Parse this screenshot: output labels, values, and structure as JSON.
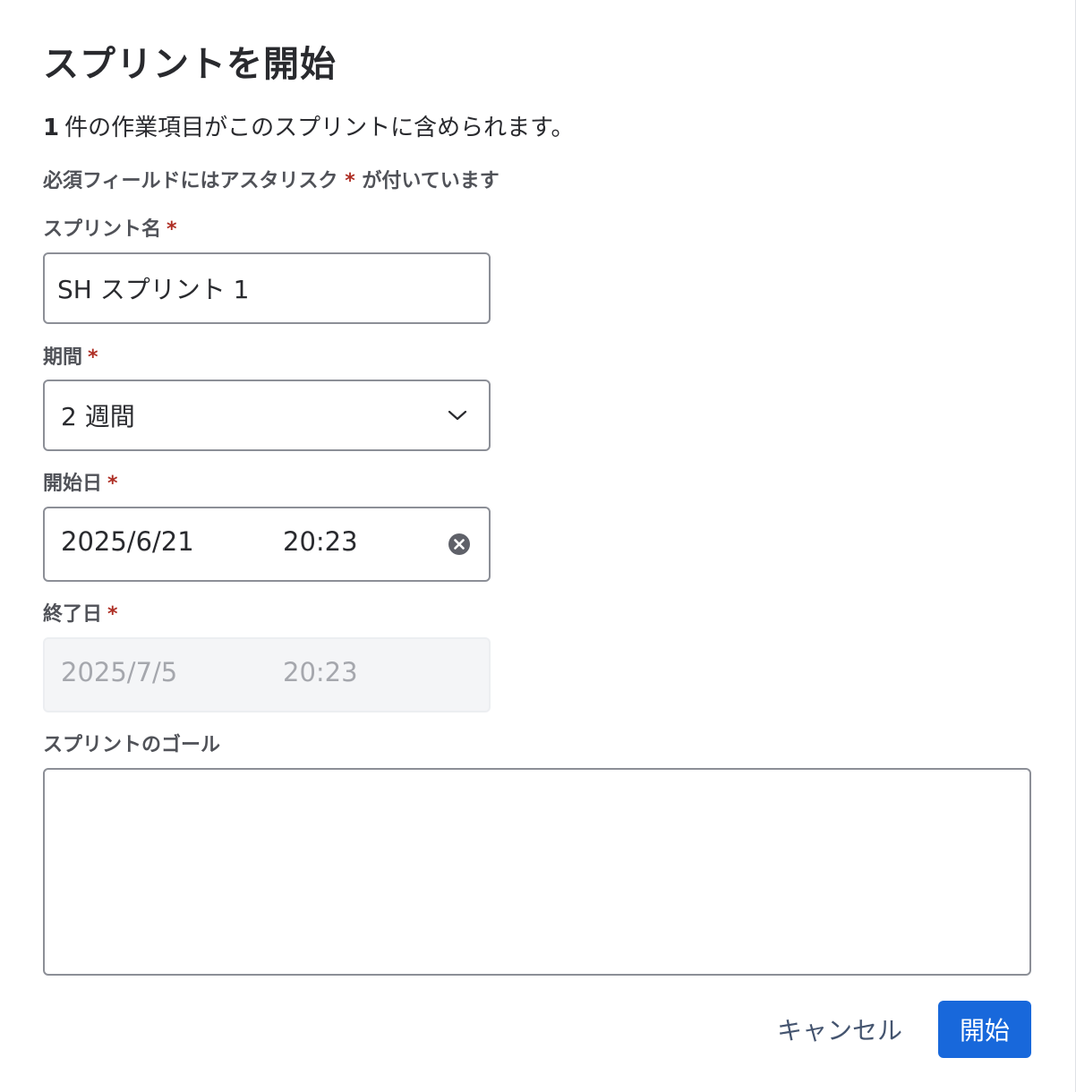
{
  "dialog": {
    "title": "スプリントを開始",
    "summary_count": "1",
    "summary_text": "件の作業項目がこのスプリントに含められます。",
    "required_note_before": "必須フィールドにはアスタリスク",
    "required_note_asterisk": "*",
    "required_note_after": "が付いています"
  },
  "fields": {
    "sprint_name": {
      "label": "スプリント名",
      "value": "SH スプリント 1"
    },
    "duration": {
      "label": "期間",
      "value": "2 週間"
    },
    "start_date": {
      "label": "開始日",
      "date": "2025/6/21",
      "time": "20:23"
    },
    "end_date": {
      "label": "終了日",
      "date": "2025/7/5",
      "time": "20:23"
    },
    "sprint_goal": {
      "label": "スプリントのゴール",
      "value": ""
    },
    "asterisk": "*"
  },
  "buttons": {
    "cancel": "キャンセル",
    "start": "開始"
  },
  "colors": {
    "primary": "#1868db",
    "required": "#ae2e24",
    "text": "#292a2e",
    "border": "#8c8f97"
  },
  "icons": {
    "chevron": "chevron-down-icon",
    "clear": "clear-icon"
  }
}
